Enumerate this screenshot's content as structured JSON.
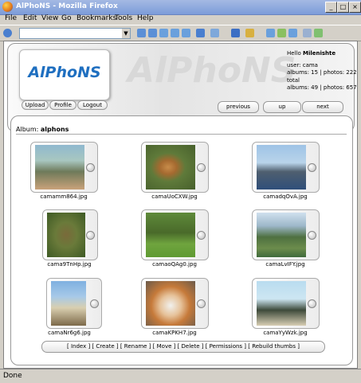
{
  "window": {
    "title": "AlPhoNS - Mozilla Firefox"
  },
  "menu": [
    "File",
    "Edit",
    "View",
    "Go",
    "Bookmarks",
    "Tools",
    "Help"
  ],
  "header": {
    "logo_text": "AlPhoNS",
    "buttons": {
      "upload": "Upload",
      "profile": "Profile",
      "logout": "Logout"
    },
    "greeting_prefix": "Hello",
    "user_name": "Milenishte",
    "user_line": "user: cama",
    "user_stats": "albums: 15 | photos: 222",
    "total_label": "total",
    "total_stats": "albums: 49 | photos: 657"
  },
  "nav": {
    "previous": "previous",
    "up": "up",
    "next": "next",
    "first": "«",
    "middle": "«",
    "last": "»"
  },
  "album": {
    "label": "Album:",
    "name": "alphons"
  },
  "photos": [
    {
      "filename": "camamm864.jpg"
    },
    {
      "filename": "camaUoCXW.jpg"
    },
    {
      "filename": "camadqOvA.jpg"
    },
    {
      "filename": "cama9TnHp.jpg"
    },
    {
      "filename": "camaoQAg0.jpg"
    },
    {
      "filename": "camaLvIFY.jpg"
    },
    {
      "filename": "camaNr6g6.jpg"
    },
    {
      "filename": "camaKPKH7.jpg"
    },
    {
      "filename": "camaYyWzk.jpg"
    }
  ],
  "actions": "[ Index ] [ Create ] [ Rename ] [ Move ] [ Delete ] [ Permissions ] [ Rebuild thumbs ]",
  "status": "Done",
  "colors": {
    "accent": "#1f6fc0",
    "titlebar": "#7c9cd9"
  }
}
